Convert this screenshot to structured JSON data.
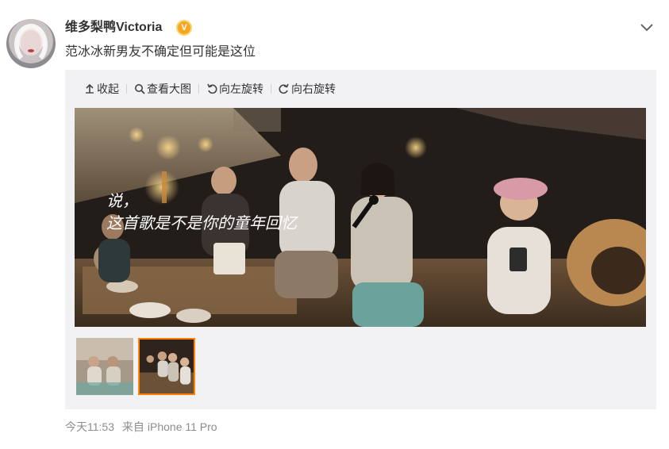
{
  "post": {
    "username": "维多梨鸭Victoria",
    "badge_icon": "verified-v-badge-icon",
    "badge_letter": "V",
    "text": "范冰冰新男友不确定但可能是这位",
    "more_icon": "chevron-down-icon"
  },
  "toolbar": {
    "items": [
      {
        "label": "收起",
        "icon": "collapse-up-arrow-icon"
      },
      {
        "label": "查看大图",
        "icon": "search-icon"
      },
      {
        "label": "向左旋转",
        "icon": "rotate-left-icon"
      },
      {
        "label": "向右旋转",
        "icon": "rotate-right-icon"
      }
    ]
  },
  "photo": {
    "overlay_line1": "说，",
    "overlay_line2": "这首歌是不是你的童年回忆"
  },
  "thumbnails": {
    "count": 2,
    "selected_index": 2
  },
  "meta": {
    "time": "今天11:53",
    "source_prefix": "来自",
    "device": "iPhone 11 Pro"
  },
  "colors": {
    "accent": "#ff8200",
    "badge": "#f6a623",
    "meta_text": "#8c8c8c",
    "media_bg": "#f2f2f5"
  }
}
